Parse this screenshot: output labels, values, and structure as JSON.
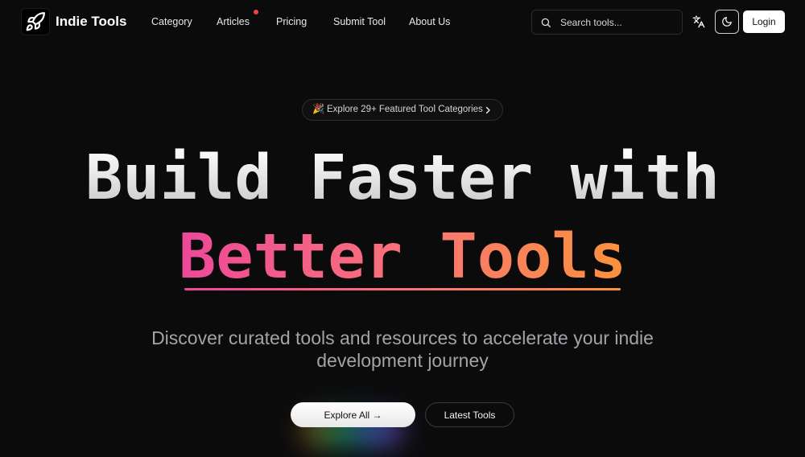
{
  "header": {
    "brand": "Indie Tools",
    "nav": [
      {
        "label": "Category"
      },
      {
        "label": "Articles"
      },
      {
        "label": "Pricing"
      },
      {
        "label": "Submit Tool"
      },
      {
        "label": "About Us"
      }
    ],
    "search_placeholder": "Search tools...",
    "login_label": "Login",
    "icons": {
      "logo": "rocket-icon",
      "search": "search-icon",
      "translate": "translate-icon",
      "theme": "moon-icon"
    },
    "notification_color": "#ef4444"
  },
  "hero": {
    "badge_emoji": "🎉",
    "badge_text": "Explore 29+ Featured Tool Categories",
    "title_line1": "Build Faster with",
    "title_line2": "Better Tools",
    "subtitle": "Discover curated tools and resources to accelerate your indie development journey",
    "primary_button": "Explore All →",
    "secondary_button": "Latest Tools",
    "gradient_colors": [
      "#ec4899",
      "#fb923c"
    ]
  }
}
